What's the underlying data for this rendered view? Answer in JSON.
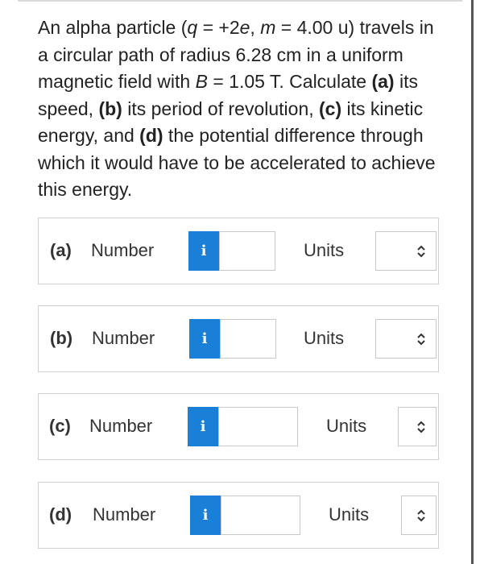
{
  "problem": {
    "t1": "An alpha particle (",
    "q_sym": "q",
    "t2": " = +2",
    "e_sym": "e",
    "t3": ", ",
    "m_sym": "m",
    "t4": " = 4.00 u) travels in a circular path of radius 6.28 cm in a uniform magnetic field with ",
    "B_sym": "B",
    "t5": " = 1.05 T. Calculate ",
    "a_tag": "(a)",
    "t6": " its speed, ",
    "b_tag": "(b)",
    "t7": " its period of revolution, ",
    "c_tag": "(c)",
    "t8": " its kinetic energy, and ",
    "d_tag": "(d)",
    "t9": " the potential difference through which it would have to be accelerated to achieve this energy."
  },
  "answers": [
    {
      "part": "(a)",
      "number_label": "Number",
      "info": "i",
      "value": "",
      "units_label": "Units",
      "units_value": ""
    },
    {
      "part": "(b)",
      "number_label": "Number",
      "info": "i",
      "value": "",
      "units_label": "Units",
      "units_value": ""
    },
    {
      "part": "(c)",
      "number_label": "Number",
      "info": "i",
      "value": "",
      "units_label": "Units",
      "units_value": ""
    },
    {
      "part": "(d)",
      "number_label": "Number",
      "info": "i",
      "value": "",
      "units_label": "Units",
      "units_value": ""
    }
  ],
  "icons": {
    "info": "info-icon",
    "select": "chevron-up-down-icon"
  },
  "colors": {
    "info_button": "#1a7fd6",
    "box_border": "#d0d0d0",
    "text": "#222222"
  }
}
